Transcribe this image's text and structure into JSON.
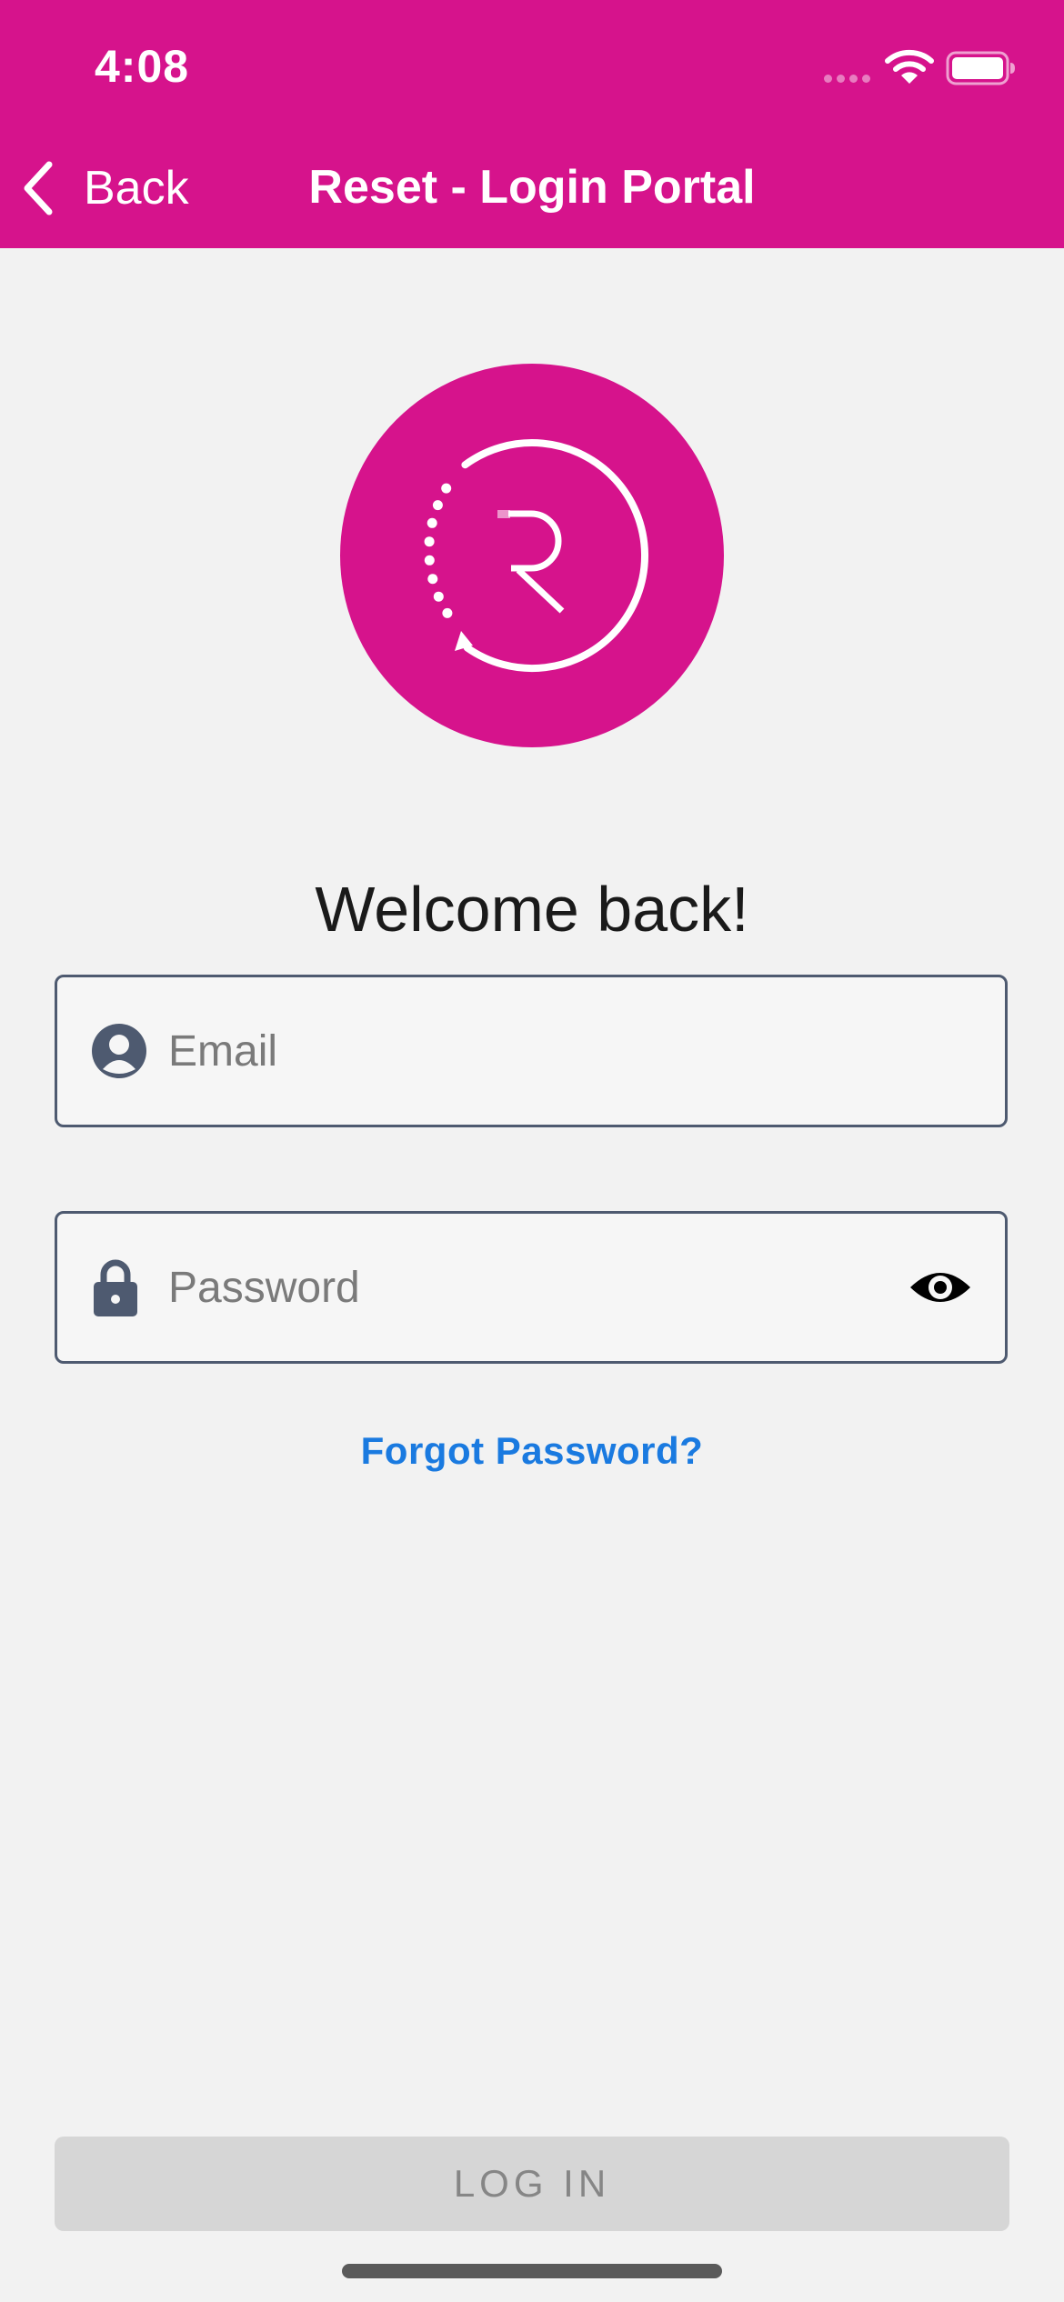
{
  "status_bar": {
    "time": "4:08"
  },
  "nav": {
    "back_label": "Back",
    "title": "Reset - Login Portal"
  },
  "logo": {
    "letter": "R",
    "brand_color": "#d6138c"
  },
  "welcome": "Welcome back!",
  "email": {
    "placeholder": "Email",
    "value": ""
  },
  "password": {
    "placeholder": "Password",
    "value": ""
  },
  "forgot_password": "Forgot Password?",
  "login_button": "LOG IN",
  "colors": {
    "accent": "#d6138c",
    "link": "#1a7ae0",
    "field_border": "#4e5a70",
    "disabled_button": "#d6d6d6"
  },
  "icons": {
    "back": "chevron-left-icon",
    "email": "user-circle-icon",
    "password": "lock-icon",
    "visibility": "eye-icon",
    "wifi": "wifi-icon",
    "battery": "battery-icon"
  }
}
